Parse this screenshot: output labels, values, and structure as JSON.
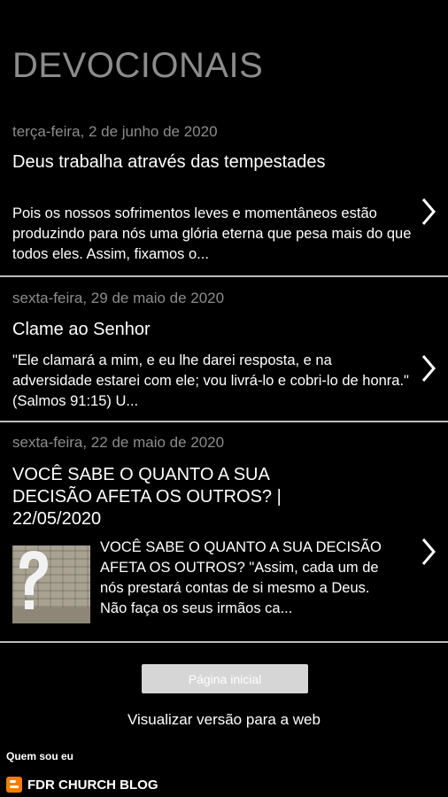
{
  "header": {
    "title": "DEVOCIONAIS"
  },
  "posts": [
    {
      "date": "terça-feira, 2 de junho de 2020",
      "title": "Deus trabalha através das tempestades",
      "snippet": "Pois os nossos sofrimentos leves e momentâneos estão produzindo para nós uma glória eterna que pesa mais do que todos eles. Assim, fixamos o..."
    },
    {
      "date": "sexta-feira, 29 de maio de 2020",
      "title": "Clame ao Senhor",
      "snippet": "\"Ele clamará a mim, e eu lhe darei resposta, e na adversidade estarei com ele; vou livrá-lo e cobri-lo de honra.\" (Salmos 91:15) U..."
    },
    {
      "date": "sexta-feira, 22 de maio de 2020",
      "title": "VOCÊ SABE O QUANTO A SUA DECISÃO AFETA OS OUTROS? | 22/05/2020",
      "snippet": "VOCÊ SABE O QUANTO A SUA DECISÃO AFETA OS OUTROS? \"Assim, cada um de nós prestará contas de si mesmo a Deus. Não faça os seus irmãos ca..."
    }
  ],
  "navigation": {
    "home_label": "Página inicial",
    "web_version_label": "Visualizar versão para a web"
  },
  "profile": {
    "heading": "Quem sou eu",
    "name": "FDR CHURCH BLOG"
  },
  "colors": {
    "background": "#000000",
    "muted_text": "#8c8c8c",
    "divider": "#bdbdbd",
    "blogger_orange": "#f57d00"
  }
}
